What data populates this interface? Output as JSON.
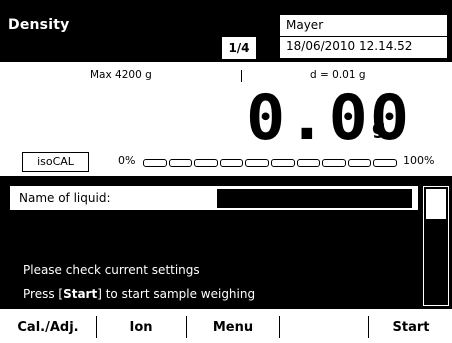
{
  "header": {
    "title": "Density",
    "page_indicator": "1/4",
    "user": "Mayer",
    "datetime": "18/06/2010 12.14.52"
  },
  "display": {
    "max_capacity": "Max 4200 g",
    "readability": "d = 0.01 g",
    "weight_value": "0.00",
    "unit": "g",
    "isocal_label": "isoCAL",
    "capacity_start": "0%",
    "capacity_end": "100%",
    "capacity_used_fraction": 0.0
  },
  "panel": {
    "field_label": "Name of liquid:",
    "field_value": "",
    "message_1": "Please check current settings",
    "message_2_prefix": "Press [",
    "message_2_key": "Start",
    "message_2_suffix": "] to start sample weighing"
  },
  "softkeys": {
    "key1": "Cal./Adj.",
    "key2": "Ion",
    "key3": "Menu",
    "key4": "",
    "key5": "Start"
  },
  "colors": {
    "foreground": "#000000",
    "background": "#ffffff"
  }
}
